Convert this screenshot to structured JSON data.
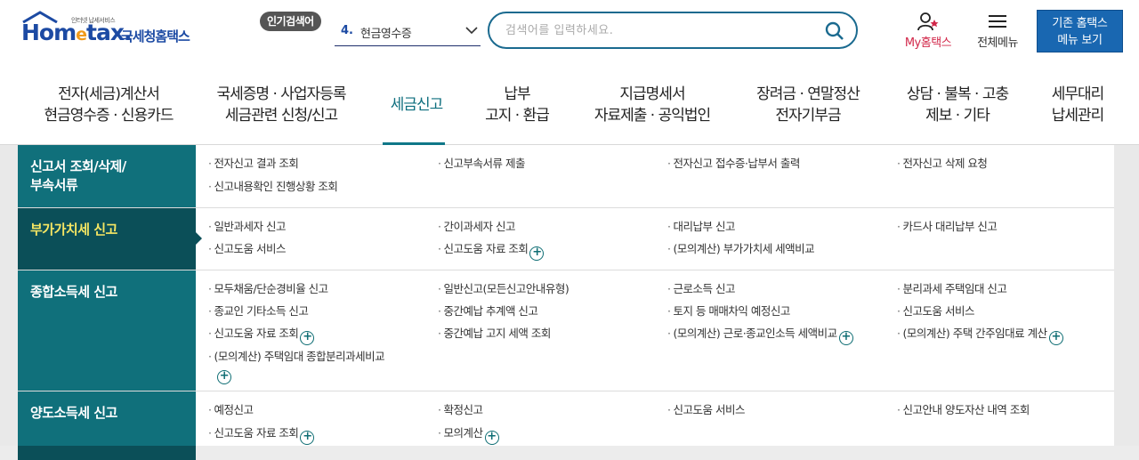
{
  "header": {
    "logo": {
      "brand": "Hometax",
      "brand_prefix": "Hom",
      "brand_e": "e",
      "brand_suffix": "tax.",
      "tagline": "인터넷 납세서비스",
      "name": "국세청홈택스"
    },
    "popular_badge": "인기검색어",
    "popular_rank": "4.",
    "popular_term": "현금영수증",
    "search_placeholder": "검색어를 입력하세요.",
    "my_hometax": "My홈택스",
    "all_menu": "전체메뉴",
    "old_menu_line1": "기존 홈택스",
    "old_menu_line2": "메뉴 보기"
  },
  "gnb": [
    {
      "line1": "전자(세금)계산서",
      "line2": "현금영수증 · 신용카드"
    },
    {
      "line1": "국세증명 · 사업자등록",
      "line2": "세금관련 신청/신고"
    },
    {
      "line1": "세금신고",
      "line2": ""
    },
    {
      "line1": "납부",
      "line2": "고지 · 환급"
    },
    {
      "line1": "지급명세서",
      "line2": "자료제출 · 공익법인"
    },
    {
      "line1": "장려금 · 연말정산",
      "line2": "전자기부금"
    },
    {
      "line1": "상담 · 불복 · 고충",
      "line2": "제보 · 기타"
    },
    {
      "line1": "세무대리",
      "line2": "납세관리"
    }
  ],
  "sections": [
    {
      "title_line1": "신고서 조회/삭제/",
      "title_line2": "부속서류",
      "links": [
        "전자신고 결과 조회",
        "신고부속서류 제출",
        "전자신고 접수증·납부서 출력",
        "전자신고 삭제 요청",
        "신고내용확인 진행상황 조회"
      ]
    },
    {
      "title_line1": "부가가치세 신고",
      "links": [
        "일반과세자 신고",
        "간이과세자 신고",
        "대리납부 신고",
        "카드사 대리납부 신고",
        "신고도움 서비스",
        "신고도움 자료 조회",
        "(모의계산) 부가가치세 세액비교"
      ]
    },
    {
      "title_line1": "종합소득세 신고",
      "links": [
        "모두채움/단순경비율 신고",
        "일반신고(모든신고안내유형)",
        "근로소득 신고",
        "분리과세 주택임대 신고",
        "종교인 기타소득 신고",
        "중간예납 추계액 신고",
        "토지 등 매매차익 예정신고",
        "신고도움 서비스",
        "신고도움 자료 조회",
        "중간예납 고지 세액 조회",
        "(모의계산) 근로·종교인소득 세액비교",
        "(모의계산) 주택 간주임대료 계산",
        "(모의계산) 주택임대 종합분리과세비교"
      ]
    },
    {
      "title_line1": "양도소득세 신고",
      "links": [
        "예정신고",
        "확정신고",
        "신고도움 서비스",
        "신고안내 양도자산 내역 조회",
        "신고도움 자료 조회",
        "모의계산"
      ]
    }
  ],
  "colors": {
    "accent": "#10707b",
    "accent_dark": "#0b4f58",
    "highlight": "#f5e663",
    "brand_blue": "#1c4aa3",
    "my_red": "#d2284a",
    "old_menu_blue": "#1967b1"
  }
}
